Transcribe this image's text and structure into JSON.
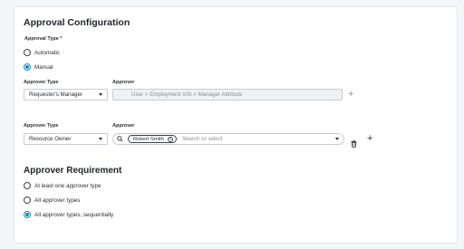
{
  "section_title": "Approval Configuration",
  "approval_type": {
    "label": "Approval Type *",
    "options": [
      {
        "label": "Automatic",
        "selected": false
      },
      {
        "label": "Manual",
        "selected": true
      }
    ]
  },
  "row1": {
    "type_label": "Approver Type",
    "approver_label": "Approver",
    "type_value": "Requester's Manager",
    "approver_value": "User > Employment Info > Manager Attribute",
    "add_icon": "plus-icon"
  },
  "row2": {
    "type_label": "Approver Type",
    "approver_label": "Approver",
    "type_value": "Resource Owner",
    "chip_label": "Robert Smith",
    "placeholder": "Search or select",
    "icons": [
      "search-icon",
      "close-circle-icon",
      "caret-down-icon",
      "trash-icon",
      "plus-icon"
    ]
  },
  "requirement_title": "Approver Requirement",
  "requirement_options": [
    {
      "label": "At least one approver type",
      "selected": false
    },
    {
      "label": "All approver types",
      "selected": false
    },
    {
      "label": "All approver types, sequentially",
      "selected": true
    }
  ],
  "colors": {
    "accent": "#1b8bc4",
    "border": "#c7ccd2",
    "disabled_bg": "#eff1f3"
  }
}
